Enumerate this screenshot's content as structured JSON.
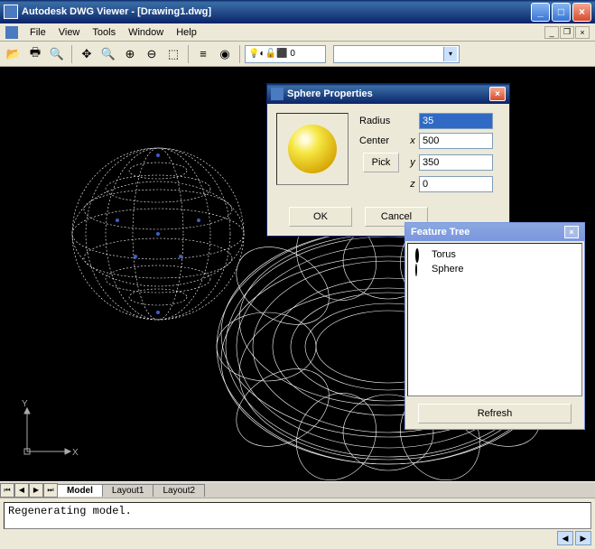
{
  "window": {
    "title": "Autodesk DWG Viewer - [Drawing1.dwg]"
  },
  "menu": {
    "file": "File",
    "view": "View",
    "tools": "Tools",
    "window": "Window",
    "help": "Help"
  },
  "toolbar": {
    "layer_selected": "0"
  },
  "axis": {
    "x": "X",
    "y": "Y"
  },
  "tabs": {
    "model": "Model",
    "layout1": "Layout1",
    "layout2": "Layout2"
  },
  "command": {
    "text": "Regenerating model."
  },
  "sphere_dialog": {
    "title": "Sphere Properties",
    "radius_label": "Radius",
    "radius_value": "35",
    "center_label": "Center",
    "x_label": "x",
    "x_value": "500",
    "y_label": "y",
    "y_value": "350",
    "z_label": "z",
    "z_value": "0",
    "pick": "Pick",
    "ok": "OK",
    "cancel": "Cancel"
  },
  "feature_tree": {
    "title": "Feature Tree",
    "items": [
      "Torus",
      "Sphere"
    ],
    "refresh": "Refresh"
  }
}
